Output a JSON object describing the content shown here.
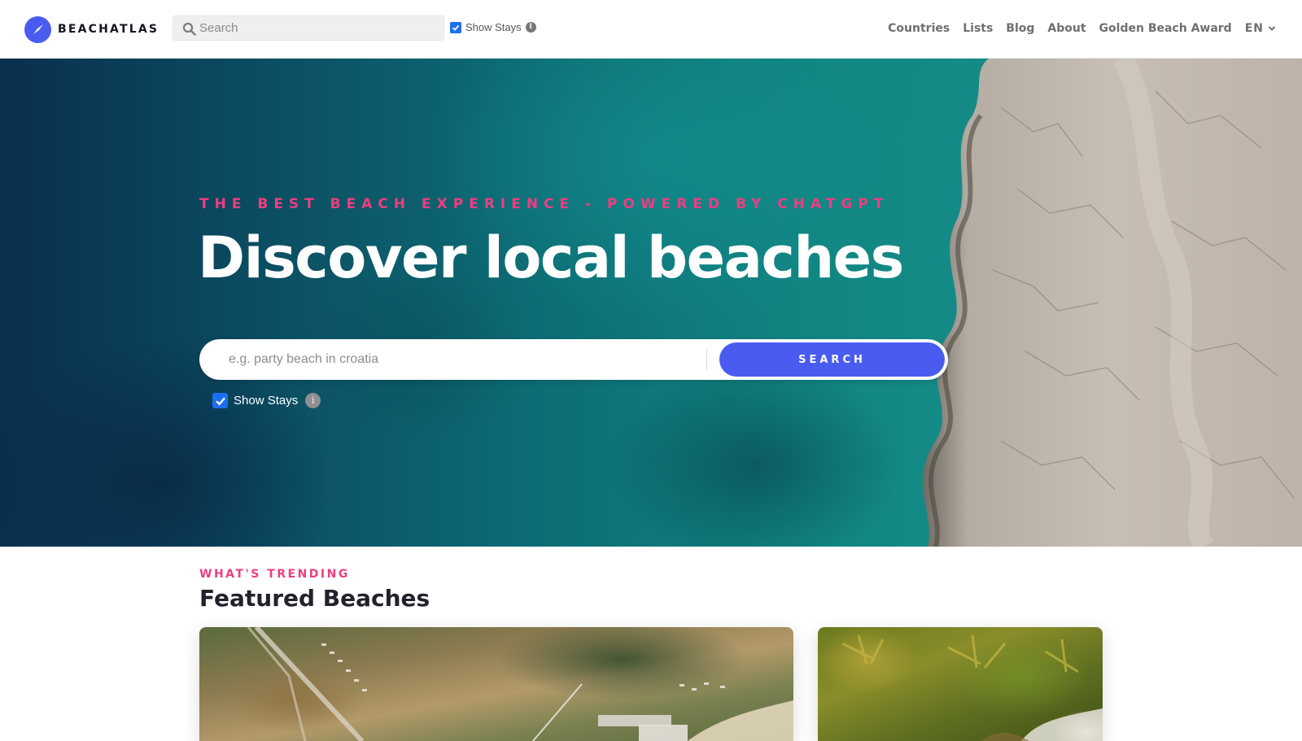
{
  "brand": {
    "name": "BEACHATLAS",
    "accent": "#4a5cf0",
    "highlight": "#ef3d80"
  },
  "nav": {
    "search_placeholder": "Search",
    "show_stays_label": "Show Stays",
    "show_stays_checked": true,
    "info_icon": "info-icon",
    "links": [
      "Countries",
      "Lists",
      "Blog",
      "About",
      "Golden Beach Award"
    ],
    "language": "EN"
  },
  "hero": {
    "kicker": "THE BEST BEACH EXPERIENCE - POWERED BY CHATGPT",
    "headline": "Discover local beaches",
    "search_placeholder": "e.g. party beach in croatia",
    "search_button": "SEARCH",
    "show_stays_label": "Show Stays",
    "show_stays_checked": true
  },
  "featured": {
    "eyebrow": "WHAT'S TRENDING",
    "title": "Featured Beaches"
  }
}
